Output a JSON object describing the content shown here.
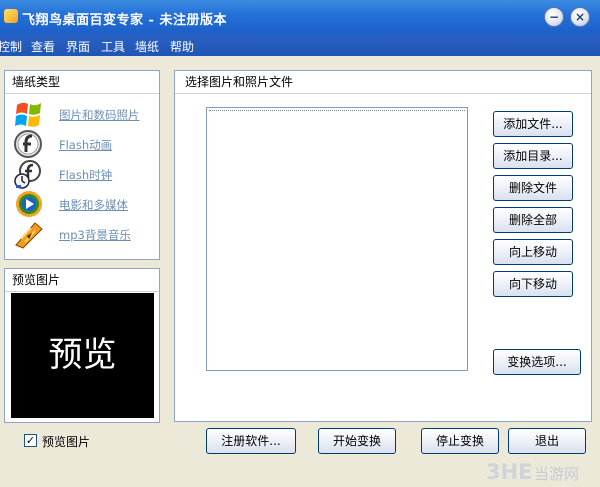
{
  "window": {
    "title": "飞翔鸟桌面百变专家 - 未注册版本",
    "minimize_glyph": "−",
    "close_glyph": "×"
  },
  "menu": [
    "控制",
    "查看",
    "界面",
    "工具",
    "墙纸",
    "帮助"
  ],
  "wallpaper_types": {
    "header": "墙纸类型",
    "items": [
      {
        "label": "图片和数码照片",
        "icon": "windows-flag-icon"
      },
      {
        "label": "Flash动画",
        "icon": "flash-icon"
      },
      {
        "label": "Flash时钟",
        "icon": "flash-clock-icon"
      },
      {
        "label": "电影和多媒体",
        "icon": "media-player-icon"
      },
      {
        "label": "mp3背景音乐",
        "icon": "winamp-icon"
      }
    ]
  },
  "preview": {
    "header": "预览图片",
    "text": "预览"
  },
  "file_panel": {
    "header": "选择图片和照片文件",
    "buttons": {
      "add_file": "添加文件...",
      "add_dir": "添加目录...",
      "delete_file": "删除文件",
      "delete_all": "删除全部",
      "move_up": "向上移动",
      "move_down": "向下移动",
      "options": "变换选项..."
    }
  },
  "bottom": {
    "preview_checkbox_label": "预览图片",
    "preview_checked": true,
    "register": "注册软件...",
    "start": "开始变换",
    "stop": "停止变换",
    "exit": "退出"
  },
  "watermark": {
    "logo": "3HE",
    "site": "当游网"
  }
}
